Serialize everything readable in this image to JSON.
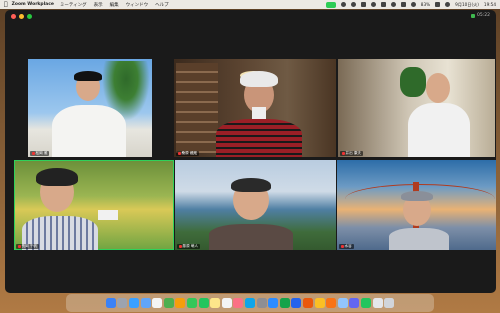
{
  "menubar": {
    "app_name": "Zoom Workplace",
    "items": [
      "ミーティング",
      "表示",
      "編集",
      "ウィンドウ",
      "ヘルプ"
    ],
    "battery_pct": "83%",
    "date": "9月10日(火)",
    "time": "19:54"
  },
  "window": {
    "elapsed": "05:22"
  },
  "participants": [
    {
      "name": "松岡 雅",
      "muted": true,
      "active": false
    },
    {
      "name": "桑原 蔵蔵",
      "muted": true,
      "active": false
    },
    {
      "name": "井出 康夫",
      "muted": true,
      "active": false
    },
    {
      "name": "長岡 千帆",
      "muted": true,
      "active": true
    },
    {
      "name": "藤原 萌人",
      "muted": true,
      "active": false
    },
    {
      "name": "水谷",
      "muted": true,
      "active": false
    }
  ],
  "dock": {
    "apps": [
      "finder-icon",
      "launchpad-icon",
      "safari-icon",
      "mail-icon",
      "calendar-icon",
      "maps-icon",
      "photos-icon",
      "messages-icon",
      "facetime-icon",
      "notes-icon",
      "reminders-icon",
      "music-icon",
      "appstore-icon",
      "settings-icon",
      "zoom-icon",
      "excel-icon",
      "word-icon",
      "powerpoint-icon",
      "chrome-icon",
      "firefox-icon",
      "preview-icon",
      "teams-icon",
      "line-icon",
      "textedit-icon",
      "trash-icon"
    ]
  },
  "colors": {
    "active_speaker": "#2fd15a",
    "muted_mic": "#e33333",
    "menubar": "#ece9e4",
    "window_bg": "#1a1a1a"
  }
}
